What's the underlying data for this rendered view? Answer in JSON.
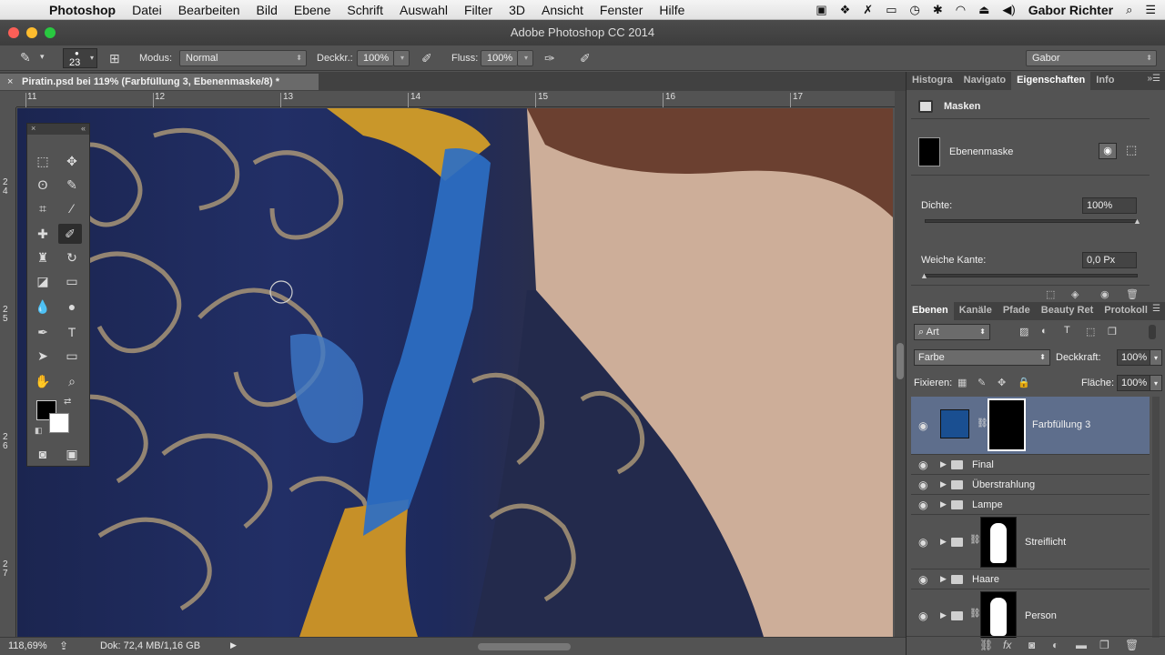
{
  "menubar": {
    "app": "Photoshop",
    "items": [
      "Datei",
      "Bearbeiten",
      "Bild",
      "Ebene",
      "Schrift",
      "Auswahl",
      "Filter",
      "3D",
      "Ansicht",
      "Fenster",
      "Hilfe"
    ],
    "user": "Gabor Richter"
  },
  "window": {
    "title": "Adobe Photoshop CC 2014"
  },
  "options": {
    "brush_size": "23",
    "modus_label": "Modus:",
    "modus_value": "Normal",
    "deckkr_label": "Deckkr.:",
    "deckkr_value": "100%",
    "fluss_label": "Fluss:",
    "fluss_value": "100%",
    "workspace": "Gabor"
  },
  "document": {
    "tab_title": "Piratin.psd bei 119% (Farbfüllung 3, Ebenenmaske/8) *",
    "ruler_h": [
      "11",
      "12",
      "13",
      "14",
      "15",
      "16",
      "17"
    ],
    "ruler_v": [
      "2 4",
      "2 5",
      "2 6",
      "2 7"
    ]
  },
  "status": {
    "zoom": "118,69%",
    "doc": "Dok: 72,4 MB/1,16 GB"
  },
  "properties_panel": {
    "tabs": [
      "Histogra",
      "Navigato",
      "Eigenschaften",
      "Info"
    ],
    "section": "Masken",
    "mask_label": "Ebenenmaske",
    "dichte_label": "Dichte:",
    "dichte_value": "100%",
    "weiche_label": "Weiche Kante:",
    "weiche_value": "0,0 Px"
  },
  "layers_panel": {
    "tabs": [
      "Ebenen",
      "Kanäle",
      "Pfade",
      "Beauty Ret",
      "Protokoll"
    ],
    "filter_label": "Art",
    "blend_mode": "Farbe",
    "deckkraft_label": "Deckkraft:",
    "deckkraft_value": "100%",
    "fixieren_label": "Fixieren:",
    "flaeche_label": "Fläche:",
    "flaeche_value": "100%",
    "layers": [
      {
        "name": "Farbfüllung 3"
      },
      {
        "name": "Final"
      },
      {
        "name": "Überstrahlung"
      },
      {
        "name": "Lampe"
      },
      {
        "name": "Streiflicht"
      },
      {
        "name": "Haare"
      },
      {
        "name": "Person"
      }
    ]
  },
  "colors": {
    "fill_color": "#1a4f91",
    "panel_bg": "#535353",
    "selected_layer": "#5e6e8c"
  }
}
